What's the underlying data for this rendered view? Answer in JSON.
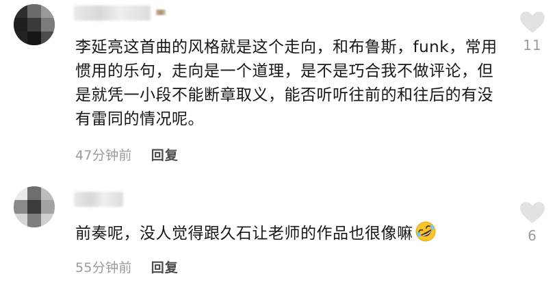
{
  "comments": [
    {
      "text": "李延亮这首曲的风格就是这个走向，和布鲁斯，funk，常用惯用的乐句，走向是一个道理，是不是巧合我不做评论，但是就凭一小段不能断章取义，能否听听往前的和往后的有没有雷同的情况呢。",
      "time": "47分钟前",
      "reply_label": "回复",
      "likes": "11",
      "icons": {
        "like": "heart-icon",
        "avatar": "user-avatar"
      }
    },
    {
      "text": "前奏呢，没人觉得跟久石让老师的作品也很像嘛",
      "time": "55分钟前",
      "reply_label": "回复",
      "likes": "6",
      "icons": {
        "like": "heart-icon",
        "avatar": "user-avatar",
        "emoji": "rolling-on-floor-laughing-emoji"
      }
    }
  ],
  "colors": {
    "meta_gray": "#9a9a9a",
    "heart_gray": "#e2e2e2",
    "reply": "#4a4a4a"
  }
}
